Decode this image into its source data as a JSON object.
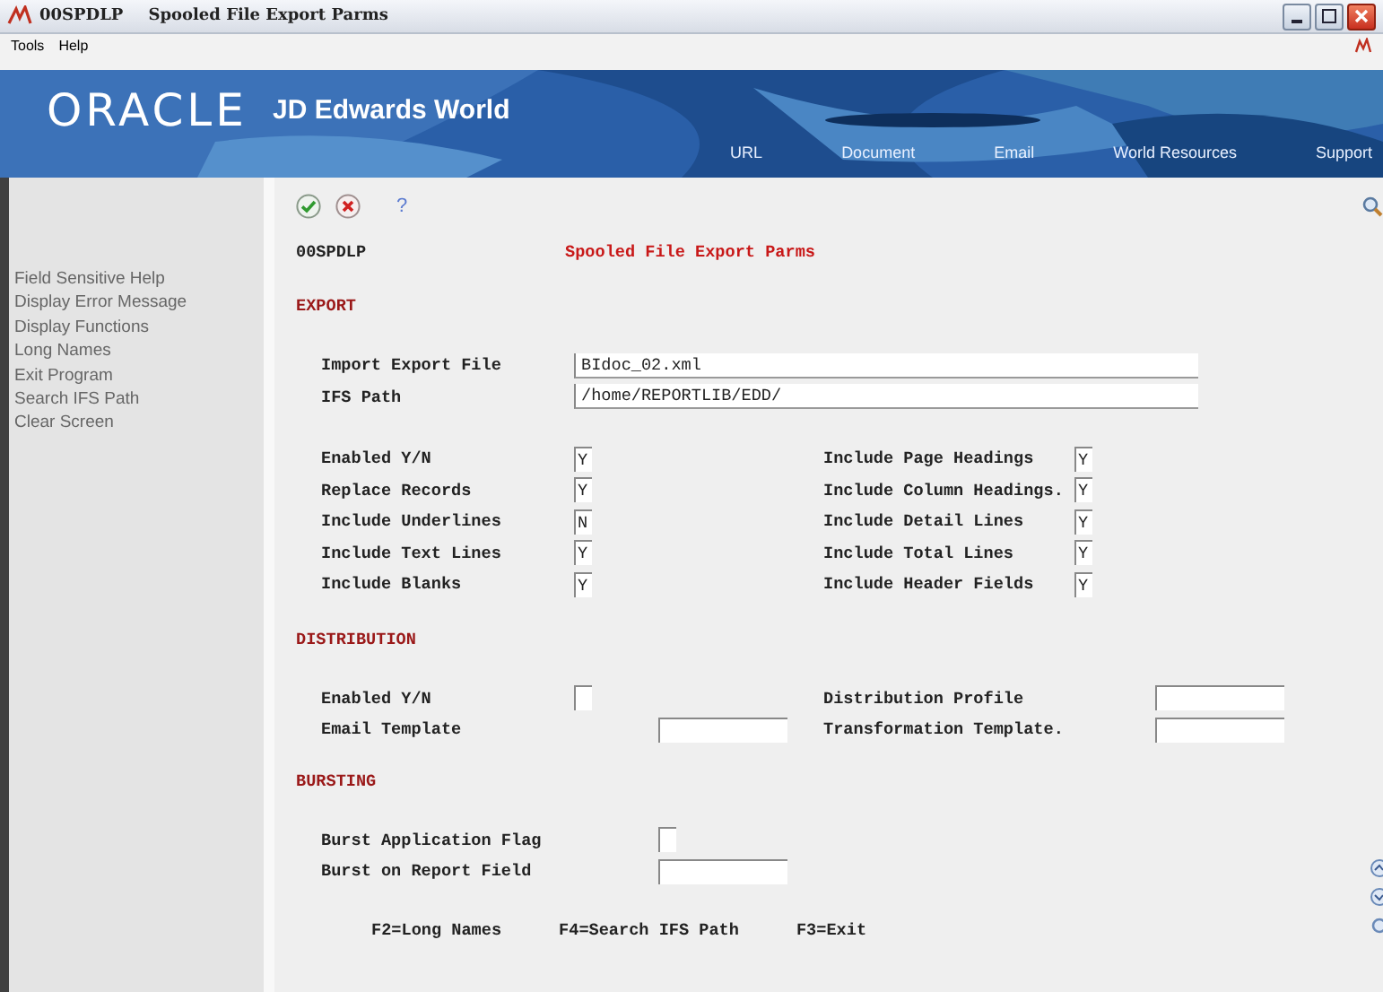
{
  "window": {
    "code": "00SPDLP",
    "title": "Spooled File Export Parms"
  },
  "menu": [
    "Tools",
    "Help"
  ],
  "banner": {
    "logo": "ORACLE",
    "product": "JD Edwards World",
    "links": [
      "URL",
      "Document",
      "Email",
      "World Resources",
      "Support"
    ]
  },
  "sidebar": {
    "items": [
      "Field Sensitive Help",
      "Display Error Message",
      "Display Functions",
      "Long Names",
      "Exit Program",
      "Search IFS Path",
      "Clear Screen"
    ]
  },
  "toolbar": {
    "help": "?"
  },
  "form": {
    "program": "00SPDLP",
    "title": "Spooled File Export Parms",
    "sections": [
      {
        "heading": "EXPORT",
        "wide": [
          {
            "label": "Import Export File",
            "value": "BIdoc_02.xml"
          },
          {
            "label": "IFS Path",
            "value": "/home/REPORTLIB/EDD/"
          }
        ],
        "columns": [
          [
            {
              "label": "Enabled Y/N",
              "kind": "flag",
              "value": "Y"
            },
            {
              "label": "Replace Records",
              "kind": "flag",
              "value": "Y"
            },
            {
              "label": "Include Underlines",
              "kind": "flag",
              "value": "N"
            },
            {
              "label": "Include Text Lines",
              "kind": "flag",
              "value": "Y"
            },
            {
              "label": "Include Blanks",
              "kind": "flag",
              "value": "Y"
            }
          ],
          [
            {
              "label": "Include Page Headings",
              "kind": "flag",
              "value": "Y"
            },
            {
              "label": "Include Column Headings.",
              "kind": "flag",
              "value": "Y"
            },
            {
              "label": "Include Detail Lines",
              "kind": "flag",
              "value": "Y"
            },
            {
              "label": "Include Total Lines",
              "kind": "flag",
              "value": "Y"
            },
            {
              "label": "Include Header Fields",
              "kind": "flag",
              "value": "Y"
            }
          ]
        ]
      },
      {
        "heading": "DISTRIBUTION",
        "columns": [
          [
            {
              "label": "Enabled Y/N",
              "kind": "flag"
            },
            {
              "label": "Email Template",
              "kind": "code"
            }
          ],
          [
            {
              "label": "Distribution Profile",
              "kind": "code"
            },
            {
              "label": "Transformation Template.",
              "kind": "code"
            }
          ]
        ]
      },
      {
        "heading": "BURSTING",
        "columns": [
          [
            {
              "label": "Burst Application Flag",
              "kind": "flag"
            },
            {
              "label": "Burst on Report Field",
              "kind": "code"
            }
          ]
        ]
      }
    ],
    "function_keys": [
      "F2=Long Names",
      "F4=Search IFS Path",
      "F3=Exit"
    ]
  }
}
